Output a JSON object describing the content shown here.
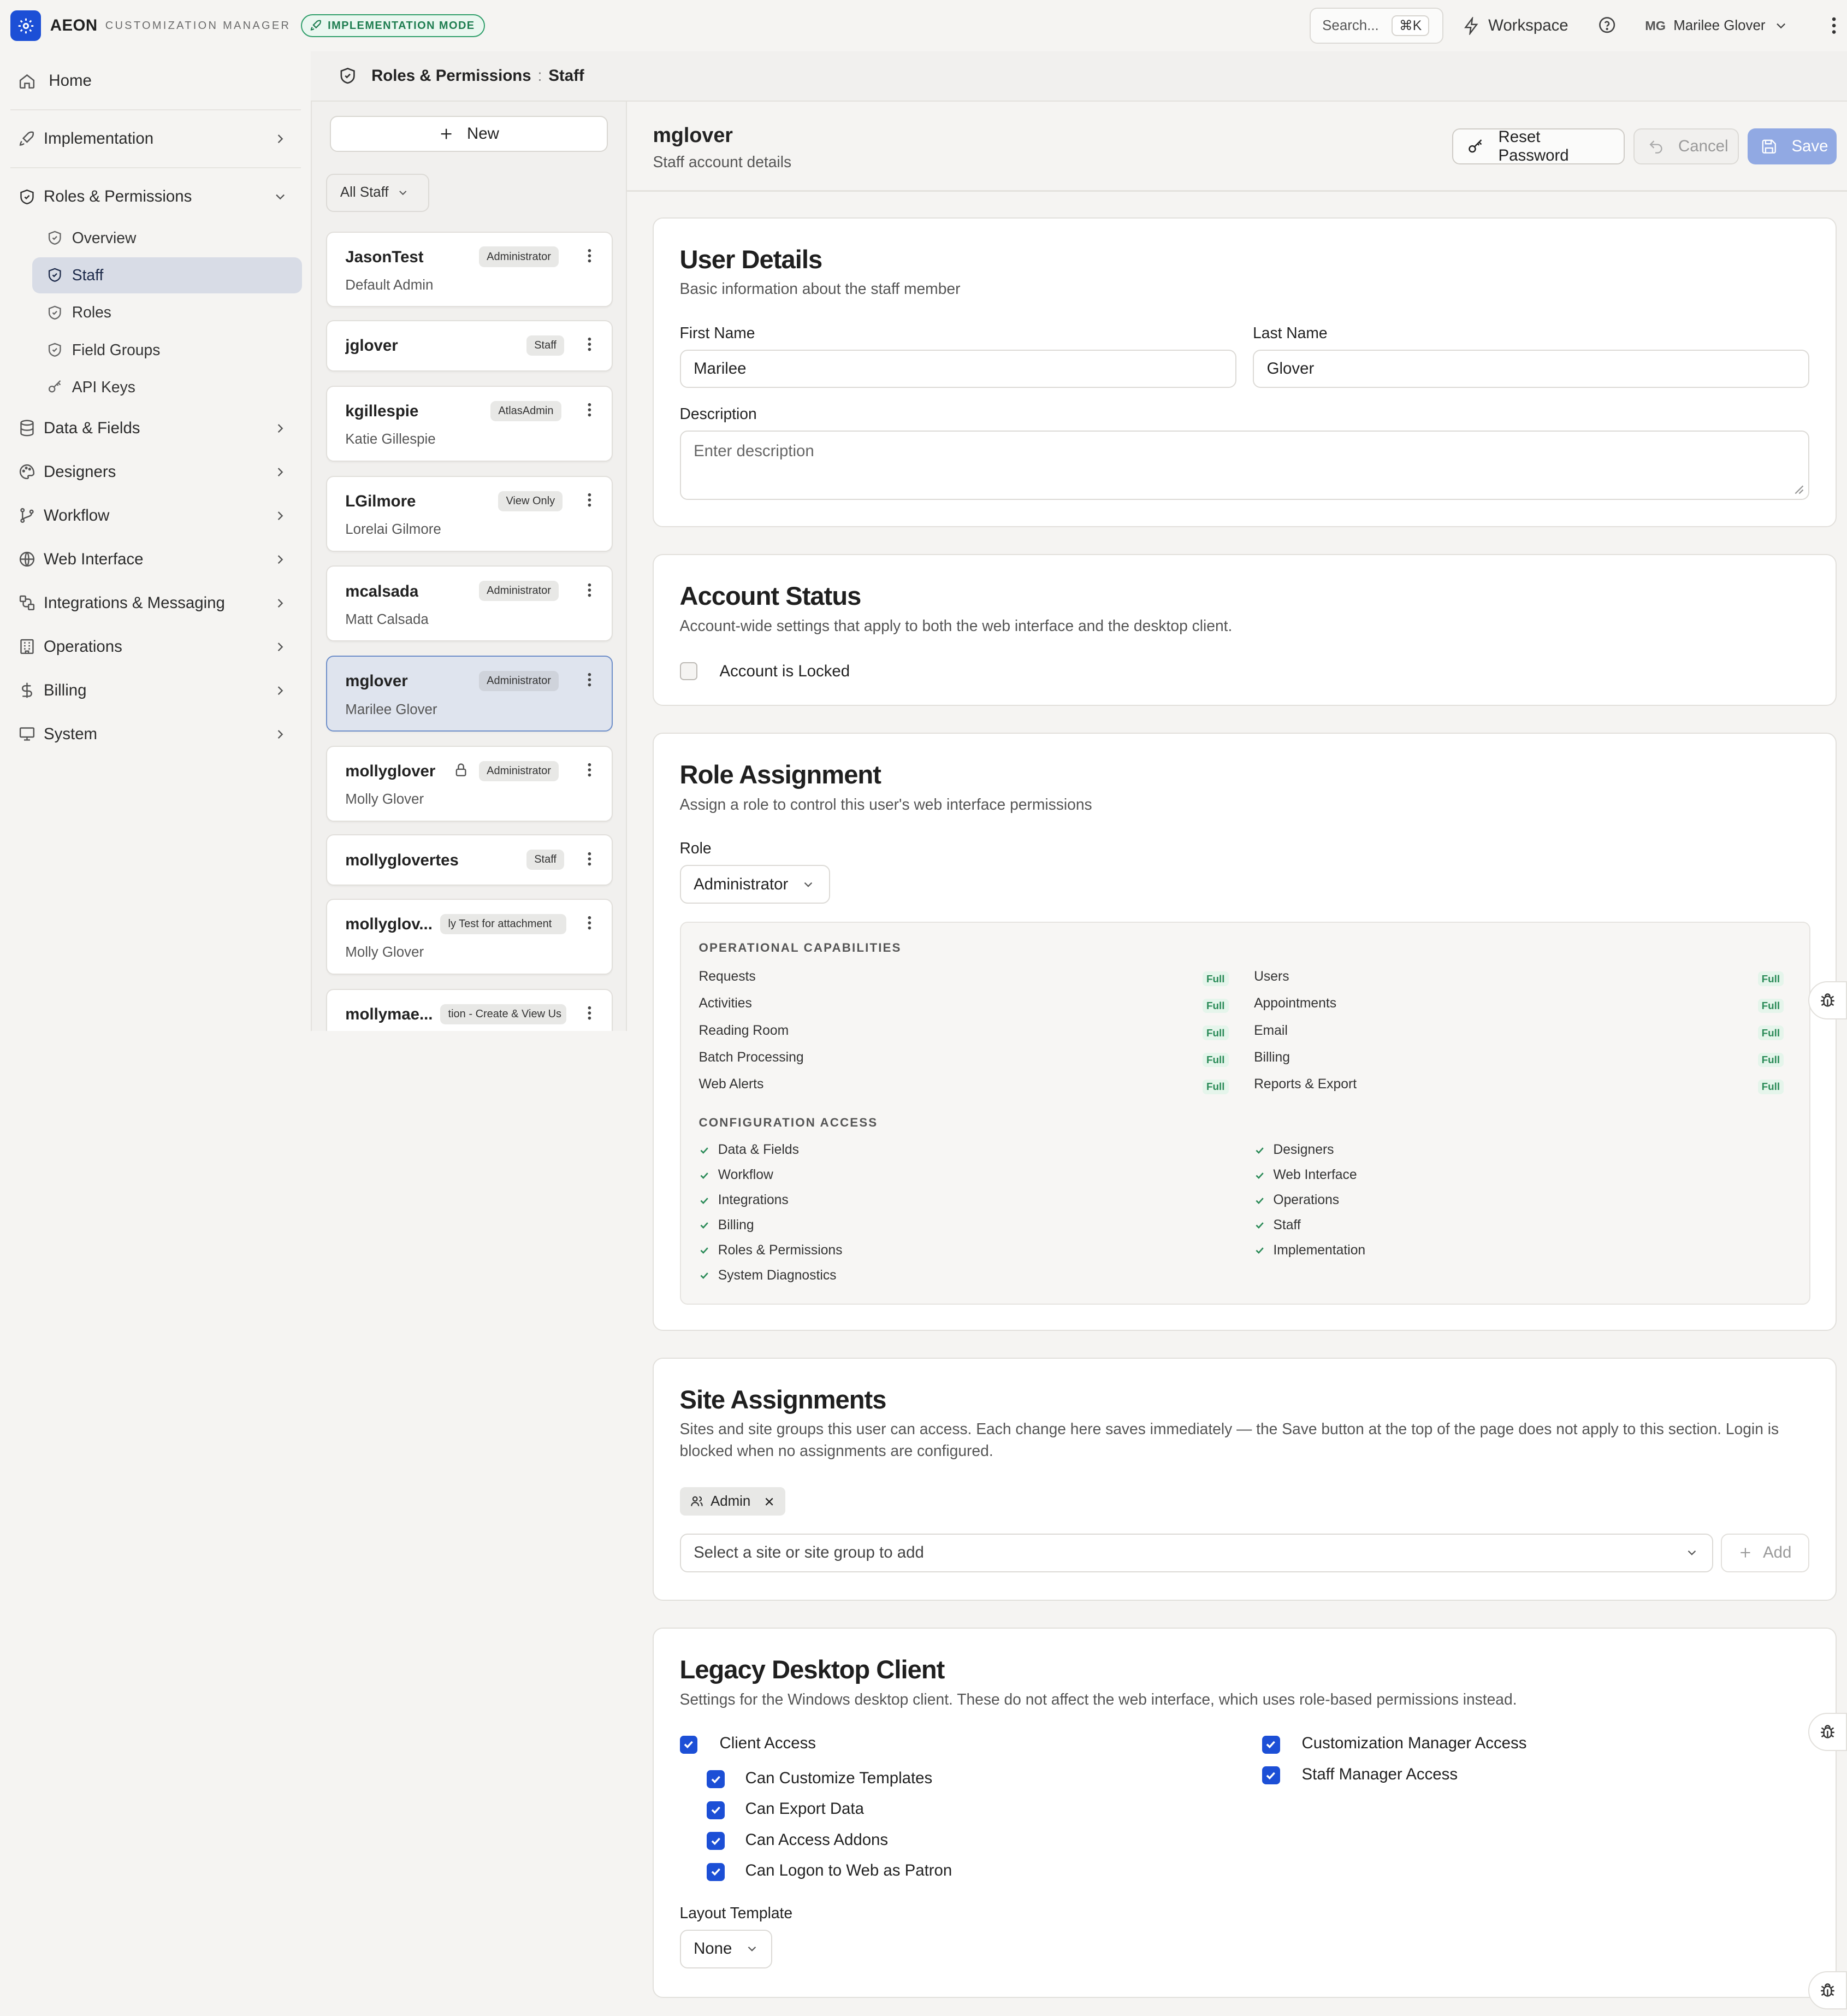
{
  "app": {
    "brand": "AEON",
    "brand_sub": "CUSTOMIZATION MANAGER",
    "mode_badge": "IMPLEMENTATION MODE",
    "search_label": "Search...",
    "search_shortcut": "⌘K",
    "workspace_label": "Workspace",
    "user_initials": "MG",
    "user_name": "Marilee Glover"
  },
  "nav": {
    "home": "Home",
    "implementation": "Implementation",
    "roles_permissions": "Roles & Permissions",
    "sub": [
      "Overview",
      "Staff",
      "Roles",
      "Field Groups",
      "API Keys"
    ],
    "data_fields": "Data & Fields",
    "designers": "Designers",
    "workflow": "Workflow",
    "web_interface": "Web Interface",
    "integrations": "Integrations & Messaging",
    "operations": "Operations",
    "billing": "Billing",
    "system": "System"
  },
  "breadcrumb": {
    "section": "Roles & Permissions",
    "separator": ":",
    "page": "Staff"
  },
  "staff_list": {
    "new_label": "New",
    "filter_label": "All Staff",
    "items": [
      {
        "username": "JasonTest",
        "role": "Administrator",
        "name": "Default Admin"
      },
      {
        "username": "jglover",
        "role": "Staff",
        "name": ""
      },
      {
        "username": "kgillespie",
        "role": "AtlasAdmin",
        "name": "Katie Gillespie"
      },
      {
        "username": "LGilmore",
        "role": "View Only",
        "name": "Lorelai Gilmore"
      },
      {
        "username": "mcalsada",
        "role": "Administrator",
        "name": "Matt Calsada"
      },
      {
        "username": "mglover",
        "role": "Administrator",
        "name": "Marilee Glover"
      },
      {
        "username": "mollyglover",
        "role": "Administrator",
        "name": "Molly Glover"
      },
      {
        "username": "mollyglovertes",
        "role": "Staff",
        "name": ""
      },
      {
        "username": "mollyglov...",
        "role": "ly Test for attachment",
        "name": "Molly Glover"
      },
      {
        "username": "mollymae...",
        "role": "tion - Create & View Us",
        "name": ""
      }
    ]
  },
  "header": {
    "title": "mglover",
    "subtitle": "Staff account details",
    "reset_label": "Reset Password",
    "cancel_label": "Cancel",
    "save_label": "Save"
  },
  "user_details": {
    "title": "User Details",
    "description": "Basic information about the staff member",
    "first_name_label": "First Name",
    "first_name": "Marilee",
    "last_name_label": "Last Name",
    "last_name": "Glover",
    "description_label": "Description",
    "description_placeholder": "Enter description"
  },
  "account_status": {
    "title": "Account Status",
    "description": "Account-wide settings that apply to both the web interface and the desktop client.",
    "locked_label": "Account is Locked",
    "locked": false
  },
  "role_assignment": {
    "title": "Role Assignment",
    "description": "Assign a role to control this user's web interface permissions",
    "role_label": "Role",
    "role_value": "Administrator",
    "operational_title": "OPERATIONAL CAPABILITIES",
    "operational": [
      {
        "name": "Requests",
        "level": "Full"
      },
      {
        "name": "Users",
        "level": "Full"
      },
      {
        "name": "Activities",
        "level": "Full"
      },
      {
        "name": "Appointments",
        "level": "Full"
      },
      {
        "name": "Reading Room",
        "level": "Full"
      },
      {
        "name": "Email",
        "level": "Full"
      },
      {
        "name": "Batch Processing",
        "level": "Full"
      },
      {
        "name": "Billing",
        "level": "Full"
      },
      {
        "name": "Web Alerts",
        "level": "Full"
      },
      {
        "name": "Reports & Export",
        "level": "Full"
      }
    ],
    "configuration_title": "CONFIGURATION ACCESS",
    "configuration": [
      "Data & Fields",
      "Designers",
      "Workflow",
      "Web Interface",
      "Integrations",
      "Operations",
      "Billing",
      "Staff",
      "Roles & Permissions",
      "Implementation",
      "System Diagnostics"
    ]
  },
  "site_assignments": {
    "title": "Site Assignments",
    "description": "Sites and site groups this user can access. Each change here saves immediately — the Save button at the top of the page does not apply to this section. Login is blocked when no assignments are configured.",
    "chips": [
      "Admin"
    ],
    "select_placeholder": "Select a site or site group to add",
    "add_label": "Add"
  },
  "legacy_client": {
    "title": "Legacy Desktop Client",
    "description": "Settings for the Windows desktop client. These do not affect the web interface, which uses role-based permissions instead.",
    "client_access": "Client Access",
    "sub_options": [
      "Can Customize Templates",
      "Can Export Data",
      "Can Access Addons",
      "Can Logon to Web as Patron"
    ],
    "right_options": [
      "Customization Manager Access",
      "Staff Manager Access"
    ],
    "layout_label": "Layout Template",
    "layout_value": "None"
  },
  "colors": {
    "accent": "#1c4fd6",
    "success": "#2a8a57",
    "active_nav": "#d8dce6"
  }
}
